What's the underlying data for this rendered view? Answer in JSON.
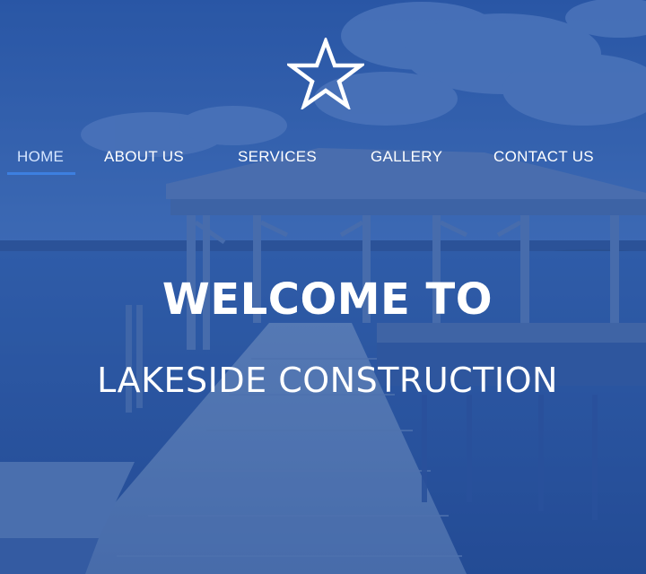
{
  "colors": {
    "overlay": "#2650a0",
    "nav_text": "#ffffff",
    "nav_active_text": "#d6e6ff",
    "nav_underline": "#3d7fe0",
    "headline": "#ffffff"
  },
  "logo": {
    "icon": "star-icon"
  },
  "nav": {
    "items": [
      {
        "label": "HOME",
        "active": true
      },
      {
        "label": "ABOUT US",
        "active": false
      },
      {
        "label": "SERVICES",
        "active": false
      },
      {
        "label": "GALLERY",
        "active": false
      },
      {
        "label": "CONTACT US",
        "active": false
      }
    ]
  },
  "hero": {
    "title": "WELCOME TO",
    "subtitle": "LAKESIDE CONSTRUCTION"
  }
}
